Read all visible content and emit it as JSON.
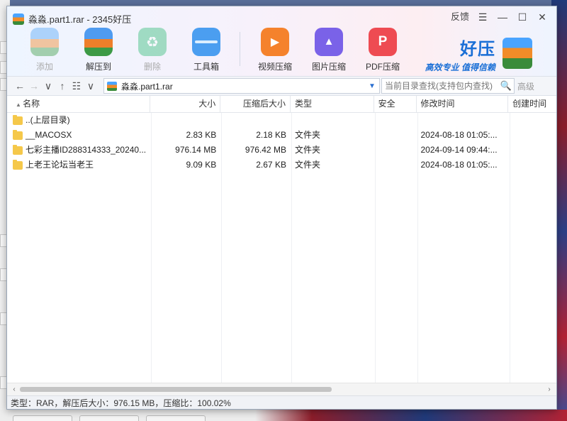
{
  "window": {
    "title": "淼淼.part1.rar - 2345好压",
    "feedback_label": "反馈",
    "menu_glyph": "☰",
    "minimize_glyph": "—",
    "maximize_glyph": "☐",
    "close_glyph": "✕"
  },
  "toolbar": {
    "add_label": "添加",
    "extract_label": "解压到",
    "delete_label": "删除",
    "toolbox_label": "工具箱",
    "video_compress_label": "视频压缩",
    "image_compress_label": "图片压缩",
    "pdf_compress_label": "PDF压缩"
  },
  "brand": {
    "name": "好压",
    "slogan": "高效专业  值得信赖"
  },
  "addressbar": {
    "back_glyph": "←",
    "forward_glyph": "→",
    "history_glyph": "∨",
    "up_glyph": "↑",
    "view_glyph": "☷",
    "view_dropdown_glyph": "∨",
    "path": "淼淼.part1.rar",
    "path_dropdown_glyph": "▼",
    "search_placeholder": "当前目录查找(支持包内查找)",
    "search_glyph": "🔍",
    "advanced_label": "高级"
  },
  "columns": {
    "name": "名称",
    "size": "大小",
    "compressed_size": "压缩后大小",
    "type": "类型",
    "security": "安全",
    "modified": "修改时间",
    "created": "创建时间"
  },
  "files": [
    {
      "name": "..(上层目录)",
      "size": "",
      "compressed": "",
      "type": "",
      "security": "",
      "modified": "",
      "created": ""
    },
    {
      "name": "__MACOSX",
      "size": "2.83 KB",
      "compressed": "2.18 KB",
      "type": "文件夹",
      "security": "",
      "modified": "2024-08-18 01:05:...",
      "created": ""
    },
    {
      "name": "七彩主播ID288314333_20240...",
      "size": "976.14 MB",
      "compressed": "976.42 MB",
      "type": "文件夹",
      "security": "",
      "modified": "2024-09-14 09:44:...",
      "created": ""
    },
    {
      "name": "上老王论坛当老王",
      "size": "9.09 KB",
      "compressed": "2.67 KB",
      "type": "文件夹",
      "security": "",
      "modified": "2024-08-18 01:05:...",
      "created": ""
    }
  ],
  "scrollbar": {
    "left_glyph": "‹",
    "right_glyph": "›"
  },
  "status": {
    "text": "类型：RAR，解压后大小：976.15 MB，压缩比：100.02%"
  },
  "colors": {
    "brand_blue": "#1a6fd6",
    "folder_yellow": "#f5c84a"
  }
}
